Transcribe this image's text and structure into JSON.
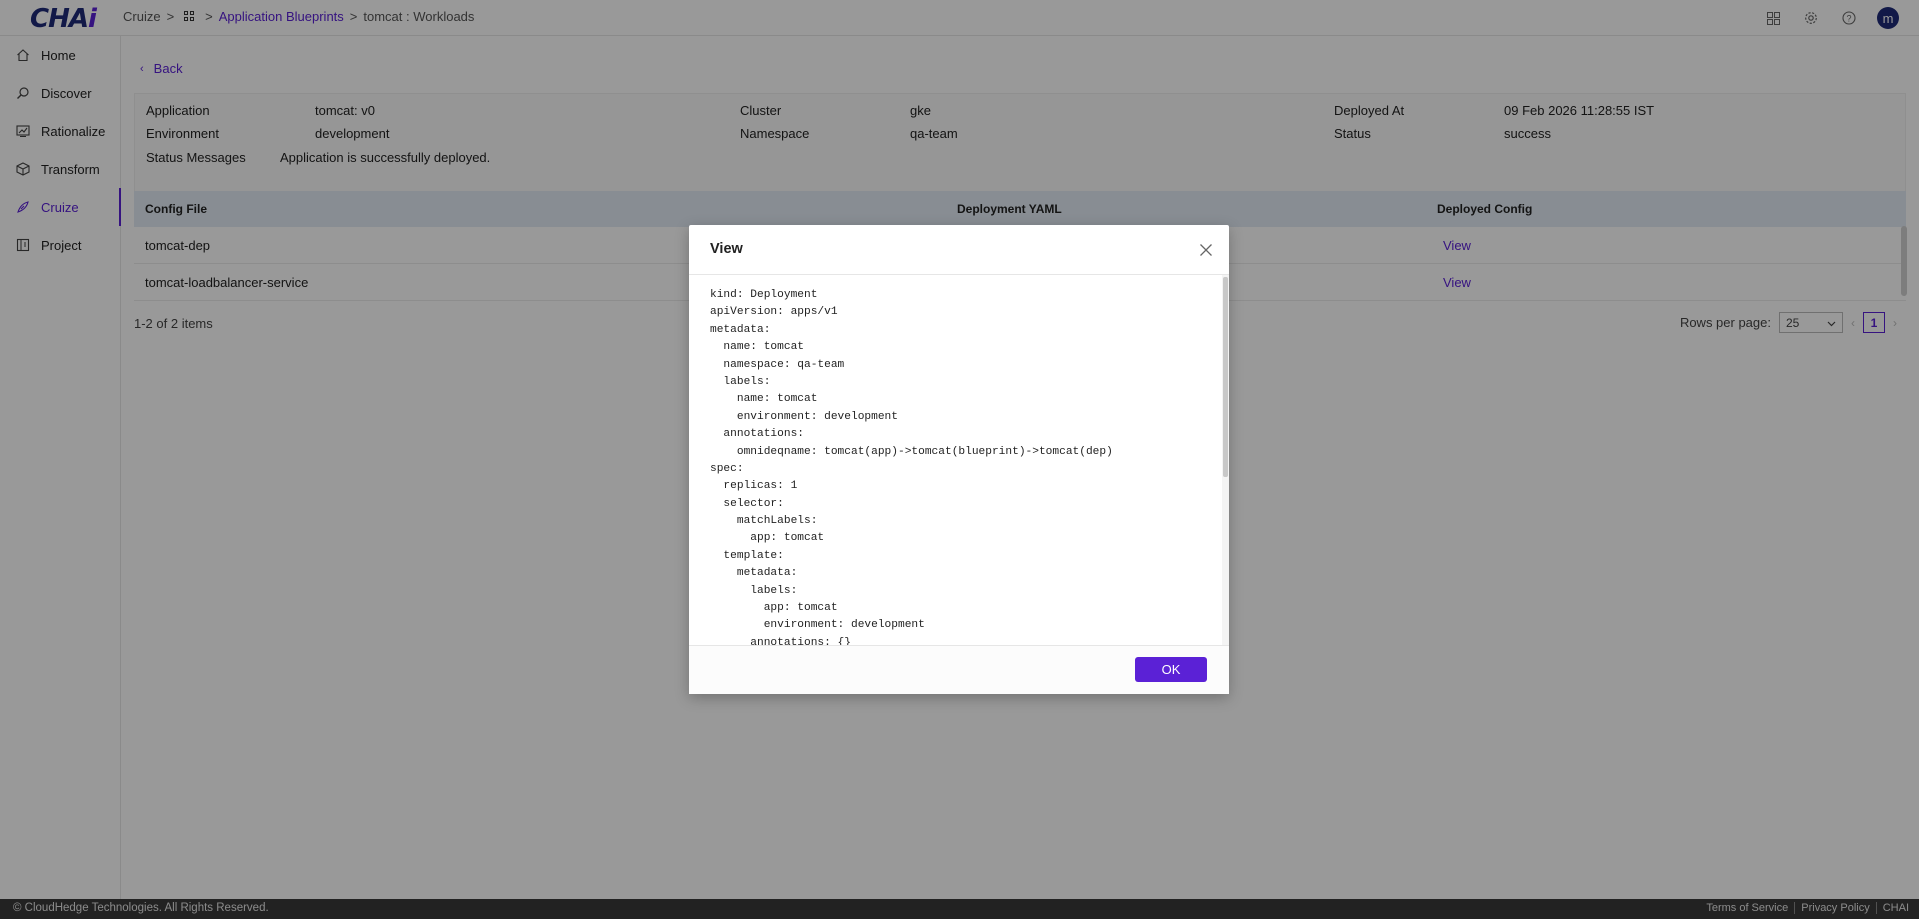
{
  "header": {
    "logo_main": "CHA",
    "logo_accent": "i",
    "breadcrumb": {
      "root": "Cruize",
      "blueprints": "Application Blueprints",
      "current": "tomcat : Workloads"
    },
    "icons": [
      "apps-grid-icon",
      "gear-icon",
      "help-icon"
    ],
    "avatar_letter": "m"
  },
  "sidebar": {
    "items": [
      {
        "label": "Home",
        "icon": "home-icon"
      },
      {
        "label": "Discover",
        "icon": "discover-icon"
      },
      {
        "label": "Rationalize",
        "icon": "rationalize-icon"
      },
      {
        "label": "Transform",
        "icon": "transform-icon"
      },
      {
        "label": "Cruize",
        "icon": "cruize-icon",
        "active": true
      },
      {
        "label": "Project",
        "icon": "project-icon"
      }
    ]
  },
  "main": {
    "back_label": "Back",
    "details": {
      "application_label": "Application",
      "application_value": "tomcat: v0",
      "environment_label": "Environment",
      "environment_value": "development",
      "status_messages_label": "Status Messages",
      "status_messages_value": "Application is successfully deployed.",
      "cluster_label": "Cluster",
      "cluster_value": "gke",
      "namespace_label": "Namespace",
      "namespace_value": "qa-team",
      "deployed_at_label": "Deployed At",
      "deployed_at_value": "09 Feb 2026 11:28:55 IST",
      "status_label": "Status",
      "status_value": "success"
    },
    "table": {
      "columns": [
        "Config File",
        "Deployment YAML",
        "Deployed Config"
      ],
      "rows": [
        {
          "config_file": "tomcat-dep",
          "deployed_config": "View"
        },
        {
          "config_file": "tomcat-loadbalancer-service",
          "deployed_config": "View"
        }
      ]
    },
    "pager": {
      "info": "1-2 of 2 items",
      "rows_per_page_label": "Rows per page:",
      "rows_per_page_value": "25",
      "prev": "‹",
      "current_page": "1",
      "next": "›"
    }
  },
  "modal": {
    "title": "View",
    "ok_label": "OK",
    "code_lines": [
      "kind: Deployment",
      "apiVersion: apps/v1",
      "metadata:",
      "  name: tomcat",
      "  namespace: qa-team",
      "  labels:",
      "    name: tomcat",
      "    environment: development",
      "  annotations:",
      "    omnideqname: tomcat(app)->tomcat(blueprint)->tomcat(dep)",
      "spec:",
      "  replicas: 1",
      "  selector:",
      "    matchLabels:",
      "      app: tomcat",
      "  template:",
      "    metadata:",
      "      labels:",
      "        app: tomcat",
      "        environment: development",
      "      annotations: {}"
    ]
  },
  "footer": {
    "copyright": "© CloudHedge Technologies. All Rights Reserved.",
    "terms": "Terms of Service",
    "privacy": "Privacy Policy",
    "brand": "CHAI"
  },
  "colors": {
    "accent": "#5b21d6",
    "brand_dark": "#1e2a78",
    "table_header": "#e3ecf6",
    "footer_bg": "#3a3a3a"
  }
}
